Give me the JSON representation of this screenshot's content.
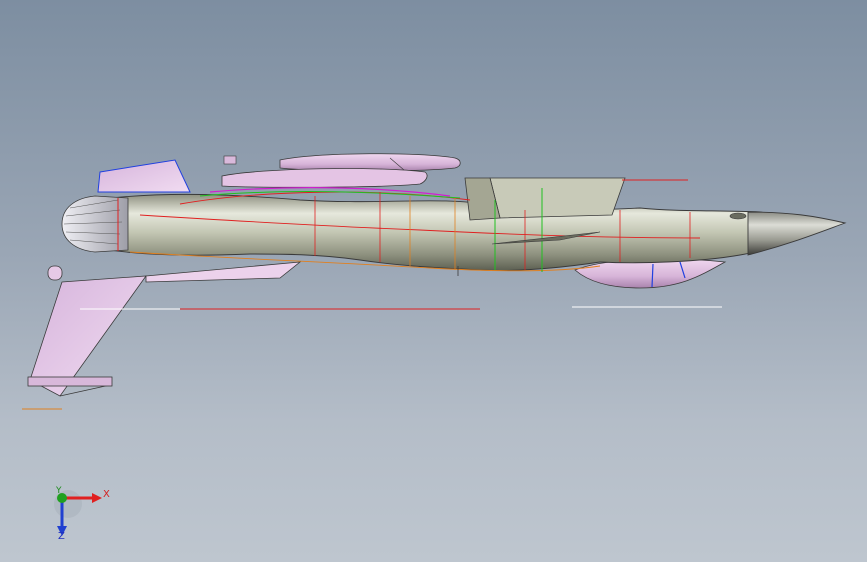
{
  "viewport": {
    "background_top": "#7d8ea1",
    "background_bottom": "#bec6cf"
  },
  "model": {
    "fuselage_color": "#b6b9a6",
    "wing_color": "#e4c3e6",
    "outline_color": "#3a3a3a",
    "edge_colors": [
      "#e02020",
      "#20c020",
      "#2040e0",
      "#e08020",
      "#d020d0"
    ]
  },
  "triad": {
    "x_label": "X",
    "y_label": "Y",
    "z_label": "Z",
    "x_color": "#e02020",
    "y_color": "#20a020",
    "z_color": "#2040d0"
  }
}
